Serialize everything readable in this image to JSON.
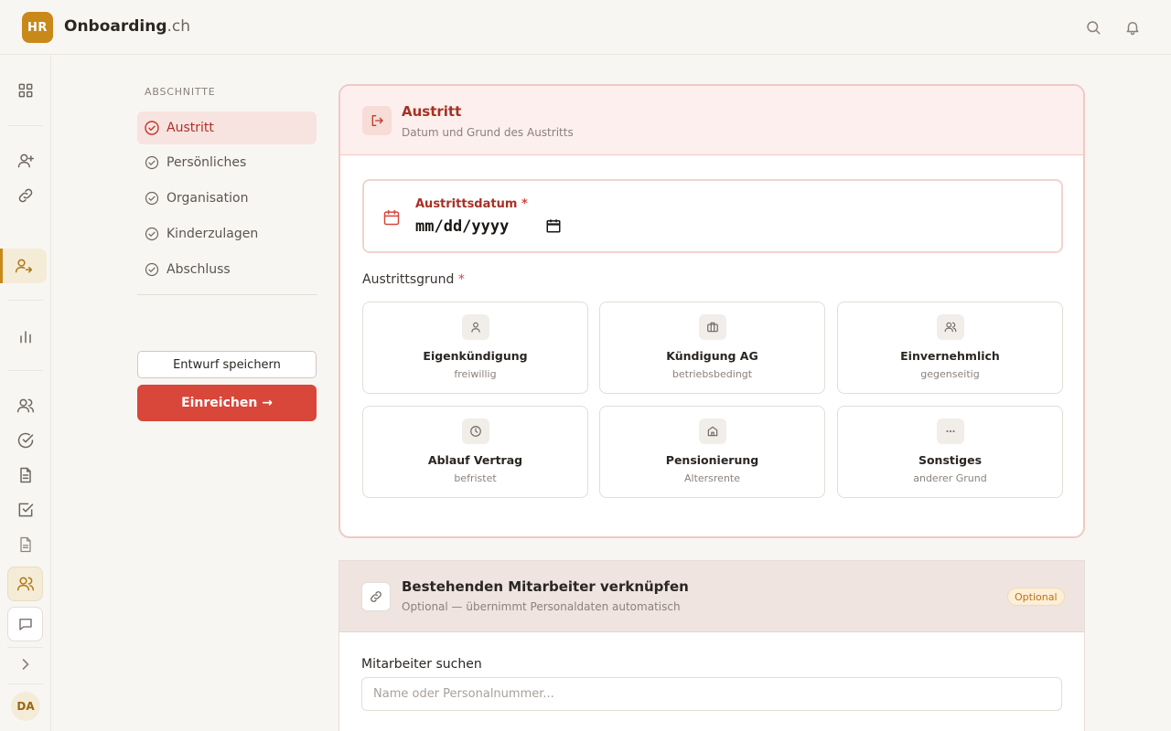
{
  "app": {
    "logo_text": "HR",
    "brand_name": "Onboarding",
    "brand_suffix": ".ch"
  },
  "header": {
    "search_icon": "search-icon",
    "notification_icon": "bell-icon"
  },
  "rail": {
    "items": [
      "grid-icon",
      "user-plus-icon",
      "link-icon",
      "user-exit-icon",
      "bar-chart-icon",
      "users-icon",
      "check-circle-icon",
      "document-icon",
      "checkbox-icon",
      "file-icon",
      "team-icon",
      "chat-icon",
      "chevron-right-icon"
    ],
    "avatar": "DA"
  },
  "sections": {
    "heading": "ABSCHNITTE",
    "items": [
      {
        "label": "Austritt",
        "active": true
      },
      {
        "label": "Persönliches",
        "active": false
      },
      {
        "label": "Organisation",
        "active": false
      },
      {
        "label": "Kinderzulagen",
        "active": false
      },
      {
        "label": "Abschluss",
        "active": false
      }
    ],
    "save_draft": "Entwurf speichern",
    "submit": "Einreichen →"
  },
  "exit_card": {
    "title": "Austritt",
    "subtitle": "Datum und Grund des Austritts",
    "date_label": "Austrittsdatum",
    "required_mark": "*",
    "date_value": "mm/dd/yyyy",
    "reason_label": "Austrittsgrund",
    "reasons": [
      {
        "title": "Eigenkündigung",
        "sub": "freiwillig",
        "icon": "person-icon"
      },
      {
        "title": "Kündigung AG",
        "sub": "betriebsbedingt",
        "icon": "briefcase-icon"
      },
      {
        "title": "Einvernehmlich",
        "sub": "gegenseitig",
        "icon": "users-icon"
      },
      {
        "title": "Ablauf Vertrag",
        "sub": "befristet",
        "icon": "clock-icon"
      },
      {
        "title": "Pensionierung",
        "sub": "Altersrente",
        "icon": "home-icon"
      },
      {
        "title": "Sonstiges",
        "sub": "anderer Grund",
        "icon": "more-icon"
      }
    ]
  },
  "link_card": {
    "title": "Bestehenden Mitarbeiter verknüpfen",
    "subtitle": "Optional — übernimmt Personaldaten automatisch",
    "badge": "Optional",
    "search_label": "Mitarbeiter suchen",
    "search_placeholder": "Name oder Personalnummer...",
    "search_value": ""
  },
  "colors": {
    "accent": "#c8891a",
    "danger": "#d9463a",
    "danger_text": "#a83024"
  }
}
